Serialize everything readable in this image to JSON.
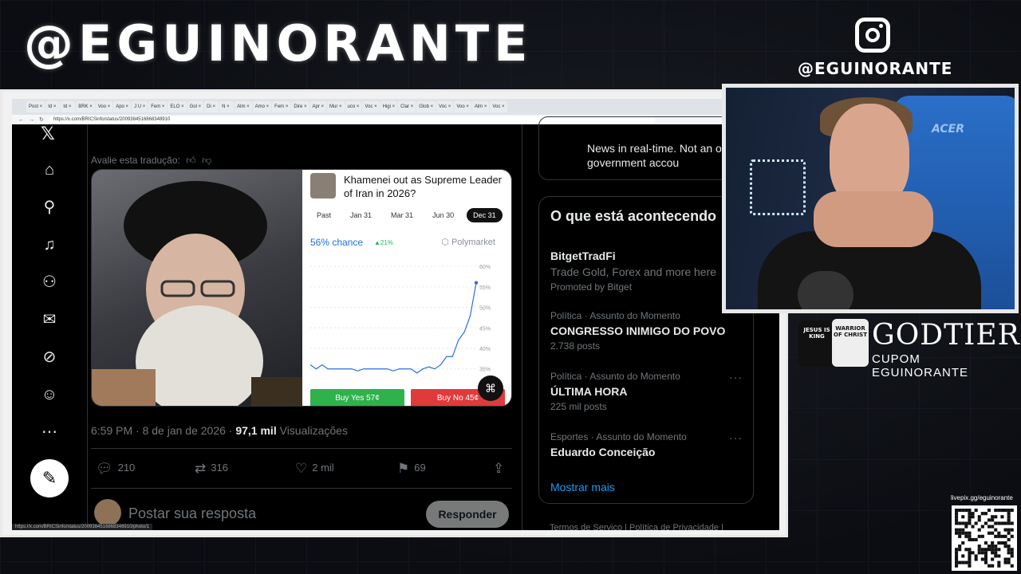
{
  "overlay": {
    "brand": "@EGUINORANTE",
    "instagram_handle": "@EGUINORANTE",
    "sponsor_name": "GODTIER",
    "sponsor_code": "CUPOM EGUINORANTE",
    "shirt_a_text": "JESUS IS KING",
    "shirt_b_text": "WARRIOR OF CHRIST",
    "chair_brand": "ACER",
    "qr_label": "livepix.gg/eguinorante"
  },
  "browser": {
    "url": "https://x.com/BRICSinfo/status/2009384516868348910",
    "status_url": "https://x.com/BRICSinfo/status/2009384516868348910/photo/1",
    "tabs": [
      "Post",
      "Id",
      "Id",
      "BRK",
      "Voo",
      "Apo",
      "J U",
      "Fem",
      "ELO",
      "Gol",
      "Di",
      "N",
      "Alm",
      "Amo",
      "Fem",
      "Dire",
      "Apr",
      "Mur",
      "uco",
      "Voc",
      "Higi",
      "Clar",
      "Glob",
      "Voc",
      "Voo",
      "Alm",
      "Voc"
    ]
  },
  "x": {
    "rate_translation": "Avalie esta tradução:",
    "market": {
      "title": "Khamenei out as Supreme Leader of Iran in 2026?",
      "tabs": [
        "Past",
        "Jan 31",
        "Mar 31",
        "Jun 30",
        "Dec 31"
      ],
      "active_tab": "Dec 31",
      "chance": "56% chance",
      "delta": "▲21%",
      "source": "Polymarket",
      "yes": "Buy Yes 57¢",
      "no": "Buy No 45¢"
    },
    "timestamp": "6:59 PM · 8 de jan de 2026 · ",
    "views_count": "97,1 mil",
    "views_label": " Visualizações",
    "stats": {
      "replies": "210",
      "reposts": "316",
      "likes": "2 mil",
      "bookmarks": "69"
    },
    "reply_placeholder": "Postar sua resposta",
    "reply_button": "Responder",
    "news_text": "News in real-time. Not an official government accou",
    "trends_title": "O que está acontecendo",
    "trends": [
      {
        "meta": "",
        "title": "BitgetTradFi",
        "sub": "Trade Gold, Forex and more here",
        "count": "Promoted by Bitget"
      },
      {
        "meta": "Política · Assunto do Momento",
        "title": "CONGRESSO INIMIGO DO POVO",
        "sub": "",
        "count": "2.738 posts"
      },
      {
        "meta": "Política · Assunto do Momento",
        "title": "ÚLTIMA HORA",
        "sub": "",
        "count": "225 mil posts"
      },
      {
        "meta": "Esportes · Assunto do Momento",
        "title": "Eduardo Conceição",
        "sub": "",
        "count": ""
      }
    ],
    "show_more": "Mostrar mais",
    "footer": "Termos de Serviço  |  Política de Privacidade  |"
  },
  "chart_data": {
    "type": "line",
    "title": "",
    "ylabel": "",
    "y_ticks": [
      "60%",
      "55%",
      "50%",
      "45%",
      "40%",
      "35%"
    ],
    "ylim": [
      33,
      61
    ],
    "series": [
      {
        "values": [
          36,
          35,
          36,
          35,
          35,
          35,
          35,
          35,
          34.5,
          35,
          35,
          35,
          35,
          35,
          34.5,
          35,
          35,
          35,
          34,
          35,
          35.5,
          35,
          36,
          38,
          38,
          42,
          44,
          48,
          56
        ]
      }
    ]
  }
}
